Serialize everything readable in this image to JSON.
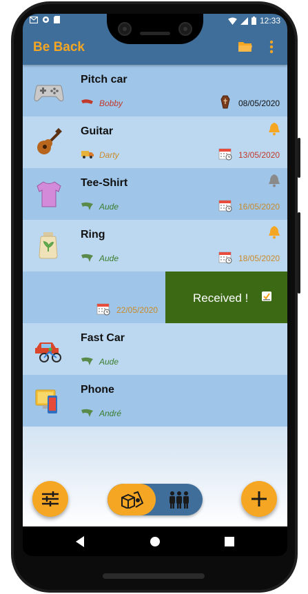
{
  "status_bar": {
    "time": "12:33"
  },
  "app": {
    "title": "Be Back"
  },
  "items": [
    {
      "title": "Pitch car",
      "person": "Bobby",
      "person_color": "#c0392b",
      "date": "08/05/2020",
      "date_color": "#111111",
      "date_icon": "coffin-icon",
      "bell": "none",
      "icon": "gamepad-icon"
    },
    {
      "title": "Guitar",
      "person": "Darty",
      "person_color": "#c98a2a",
      "date": "13/05/2020",
      "date_color": "#c0392b",
      "date_icon": "calendar-icon",
      "bell": "active",
      "icon": "guitar-icon"
    },
    {
      "title": "Tee-Shirt",
      "person": "Aude",
      "person_color": "#3a7d2c",
      "date": "16/05/2020",
      "date_color": "#c98a2a",
      "date_icon": "calendar-icon",
      "bell": "muted",
      "icon": "tshirt-icon"
    },
    {
      "title": "Ring",
      "person": "Aude",
      "person_color": "#3a7d2c",
      "date": "18/05/2020",
      "date_color": "#c98a2a",
      "date_icon": "calendar-icon",
      "bell": "active",
      "icon": "jar-icon"
    }
  ],
  "swiped_item": {
    "date": "22/05/2020",
    "action_label": "Received !"
  },
  "items_after": [
    {
      "title": "Fast Car",
      "person": "Aude",
      "person_color": "#3a7d2c",
      "icon": "car-bike-icon"
    },
    {
      "title": "Phone",
      "person": "André",
      "person_color": "#3a7d2c",
      "icon": "devices-icon"
    }
  ],
  "colors": {
    "accent": "#f5a623",
    "primary": "#3f6e9a",
    "received_bg": "#3b6914"
  }
}
